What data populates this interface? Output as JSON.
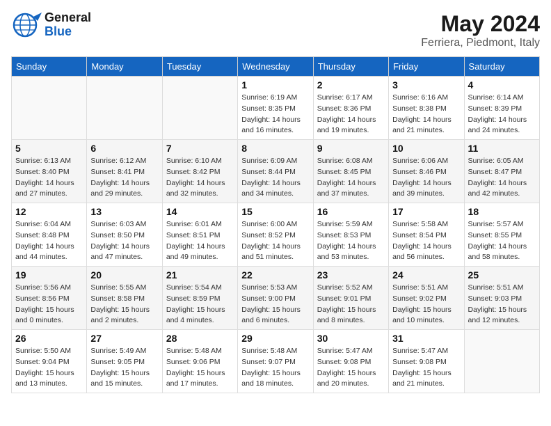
{
  "header": {
    "logo_general": "General",
    "logo_blue": "Blue",
    "month_title": "May 2024",
    "location": "Ferriera, Piedmont, Italy"
  },
  "weekdays": [
    "Sunday",
    "Monday",
    "Tuesday",
    "Wednesday",
    "Thursday",
    "Friday",
    "Saturday"
  ],
  "weeks": [
    [
      {
        "day": "",
        "info": ""
      },
      {
        "day": "",
        "info": ""
      },
      {
        "day": "",
        "info": ""
      },
      {
        "day": "1",
        "info": "Sunrise: 6:19 AM\nSunset: 8:35 PM\nDaylight: 14 hours\nand 16 minutes."
      },
      {
        "day": "2",
        "info": "Sunrise: 6:17 AM\nSunset: 8:36 PM\nDaylight: 14 hours\nand 19 minutes."
      },
      {
        "day": "3",
        "info": "Sunrise: 6:16 AM\nSunset: 8:38 PM\nDaylight: 14 hours\nand 21 minutes."
      },
      {
        "day": "4",
        "info": "Sunrise: 6:14 AM\nSunset: 8:39 PM\nDaylight: 14 hours\nand 24 minutes."
      }
    ],
    [
      {
        "day": "5",
        "info": "Sunrise: 6:13 AM\nSunset: 8:40 PM\nDaylight: 14 hours\nand 27 minutes."
      },
      {
        "day": "6",
        "info": "Sunrise: 6:12 AM\nSunset: 8:41 PM\nDaylight: 14 hours\nand 29 minutes."
      },
      {
        "day": "7",
        "info": "Sunrise: 6:10 AM\nSunset: 8:42 PM\nDaylight: 14 hours\nand 32 minutes."
      },
      {
        "day": "8",
        "info": "Sunrise: 6:09 AM\nSunset: 8:44 PM\nDaylight: 14 hours\nand 34 minutes."
      },
      {
        "day": "9",
        "info": "Sunrise: 6:08 AM\nSunset: 8:45 PM\nDaylight: 14 hours\nand 37 minutes."
      },
      {
        "day": "10",
        "info": "Sunrise: 6:06 AM\nSunset: 8:46 PM\nDaylight: 14 hours\nand 39 minutes."
      },
      {
        "day": "11",
        "info": "Sunrise: 6:05 AM\nSunset: 8:47 PM\nDaylight: 14 hours\nand 42 minutes."
      }
    ],
    [
      {
        "day": "12",
        "info": "Sunrise: 6:04 AM\nSunset: 8:48 PM\nDaylight: 14 hours\nand 44 minutes."
      },
      {
        "day": "13",
        "info": "Sunrise: 6:03 AM\nSunset: 8:50 PM\nDaylight: 14 hours\nand 47 minutes."
      },
      {
        "day": "14",
        "info": "Sunrise: 6:01 AM\nSunset: 8:51 PM\nDaylight: 14 hours\nand 49 minutes."
      },
      {
        "day": "15",
        "info": "Sunrise: 6:00 AM\nSunset: 8:52 PM\nDaylight: 14 hours\nand 51 minutes."
      },
      {
        "day": "16",
        "info": "Sunrise: 5:59 AM\nSunset: 8:53 PM\nDaylight: 14 hours\nand 53 minutes."
      },
      {
        "day": "17",
        "info": "Sunrise: 5:58 AM\nSunset: 8:54 PM\nDaylight: 14 hours\nand 56 minutes."
      },
      {
        "day": "18",
        "info": "Sunrise: 5:57 AM\nSunset: 8:55 PM\nDaylight: 14 hours\nand 58 minutes."
      }
    ],
    [
      {
        "day": "19",
        "info": "Sunrise: 5:56 AM\nSunset: 8:56 PM\nDaylight: 15 hours\nand 0 minutes."
      },
      {
        "day": "20",
        "info": "Sunrise: 5:55 AM\nSunset: 8:58 PM\nDaylight: 15 hours\nand 2 minutes."
      },
      {
        "day": "21",
        "info": "Sunrise: 5:54 AM\nSunset: 8:59 PM\nDaylight: 15 hours\nand 4 minutes."
      },
      {
        "day": "22",
        "info": "Sunrise: 5:53 AM\nSunset: 9:00 PM\nDaylight: 15 hours\nand 6 minutes."
      },
      {
        "day": "23",
        "info": "Sunrise: 5:52 AM\nSunset: 9:01 PM\nDaylight: 15 hours\nand 8 minutes."
      },
      {
        "day": "24",
        "info": "Sunrise: 5:51 AM\nSunset: 9:02 PM\nDaylight: 15 hours\nand 10 minutes."
      },
      {
        "day": "25",
        "info": "Sunrise: 5:51 AM\nSunset: 9:03 PM\nDaylight: 15 hours\nand 12 minutes."
      }
    ],
    [
      {
        "day": "26",
        "info": "Sunrise: 5:50 AM\nSunset: 9:04 PM\nDaylight: 15 hours\nand 13 minutes."
      },
      {
        "day": "27",
        "info": "Sunrise: 5:49 AM\nSunset: 9:05 PM\nDaylight: 15 hours\nand 15 minutes."
      },
      {
        "day": "28",
        "info": "Sunrise: 5:48 AM\nSunset: 9:06 PM\nDaylight: 15 hours\nand 17 minutes."
      },
      {
        "day": "29",
        "info": "Sunrise: 5:48 AM\nSunset: 9:07 PM\nDaylight: 15 hours\nand 18 minutes."
      },
      {
        "day": "30",
        "info": "Sunrise: 5:47 AM\nSunset: 9:08 PM\nDaylight: 15 hours\nand 20 minutes."
      },
      {
        "day": "31",
        "info": "Sunrise: 5:47 AM\nSunset: 9:08 PM\nDaylight: 15 hours\nand 21 minutes."
      },
      {
        "day": "",
        "info": ""
      }
    ]
  ]
}
